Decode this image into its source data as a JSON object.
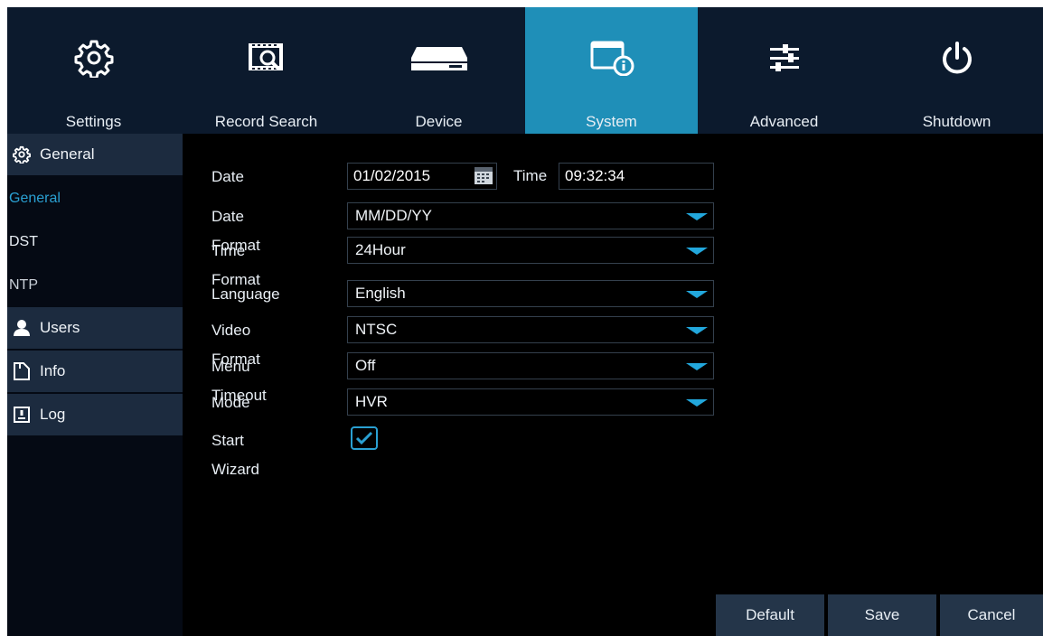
{
  "topnav": {
    "tabs": [
      {
        "label": "Settings",
        "icon": "gear-icon"
      },
      {
        "label": "Record Search",
        "icon": "record-search-icon"
      },
      {
        "label": "Device",
        "icon": "hard-drive-icon"
      },
      {
        "label": "System",
        "icon": "system-info-icon",
        "active": true
      },
      {
        "label": "Advanced",
        "icon": "sliders-icon"
      },
      {
        "label": "Shutdown",
        "icon": "power-icon"
      }
    ]
  },
  "sidebar": {
    "general_group": "General",
    "general_items": [
      "General",
      "DST",
      "NTP"
    ],
    "users": "Users",
    "info": "Info",
    "log": "Log"
  },
  "form": {
    "date_label": "Date",
    "date_value": "01/02/2015",
    "time_label": "Time",
    "time_value": "09:32:34",
    "date_format_label": "Date Format",
    "date_format_value": "MM/DD/YY",
    "time_format_label": "Time Format",
    "time_format_value": "24Hour",
    "language_label": "Language",
    "language_value": "English",
    "video_format_label": "Video Format",
    "video_format_value": "NTSC",
    "menu_timeout_label": "Menu Timeout",
    "menu_timeout_value": "Off",
    "mode_label": "Mode",
    "mode_value": "HVR",
    "start_wizard_label": "Start Wizard",
    "start_wizard_checked": true
  },
  "buttons": {
    "default": "Default",
    "save": "Save",
    "cancel": "Cancel"
  },
  "colors": {
    "accent": "#1f8fb8",
    "nav_bg": "#0c1a2d",
    "dropdown_arrow": "#22a7dc"
  }
}
